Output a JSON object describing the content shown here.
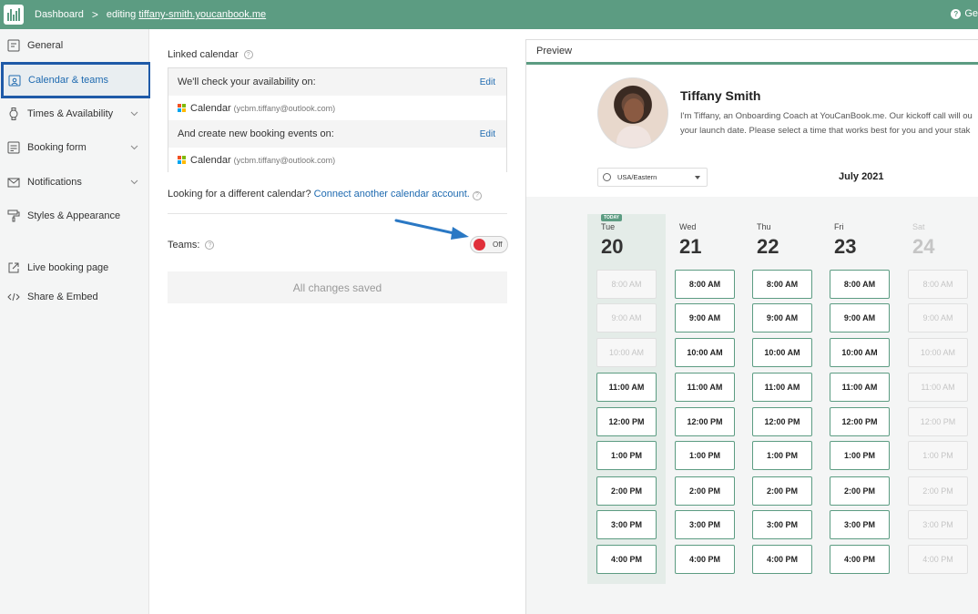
{
  "topbar": {
    "breadcrumb_root": "Dashboard",
    "breadcrumb_separator": ">",
    "editing_label": "editing",
    "editing_url": "tiffany-smith.youcanbook.me",
    "help_label": "Ge"
  },
  "sidebar": {
    "items": [
      {
        "label": "General",
        "icon": "id-card-icon"
      },
      {
        "label": "Calendar & teams",
        "icon": "calendar-user-icon",
        "active": true
      },
      {
        "label": "Times & Availability",
        "icon": "watch-icon",
        "expandable": true
      },
      {
        "label": "Booking form",
        "icon": "form-icon",
        "expandable": true
      },
      {
        "label": "Notifications",
        "icon": "envelope-icon",
        "expandable": true
      },
      {
        "label": "Styles & Appearance",
        "icon": "paint-roller-icon"
      },
      {
        "label": "Live booking page",
        "icon": "external-link-icon"
      },
      {
        "label": "Share & Embed",
        "icon": "code-icon"
      }
    ]
  },
  "main": {
    "linked_calendar_title": "Linked calendar",
    "check_label": "We'll check your availability on:",
    "check_edit": "Edit",
    "check_calendar": "Calendar",
    "check_calendar_account": "(ycbm.tiffany@outlook.com)",
    "create_label": "And create new booking events on:",
    "create_edit": "Edit",
    "create_calendar": "Calendar",
    "create_calendar_account": "(ycbm.tiffany@outlook.com)",
    "different_text": "Looking for a different calendar?",
    "different_link": "Connect another calendar account.",
    "teams_label": "Teams:",
    "teams_toggle": "Off",
    "saved_status": "All changes saved"
  },
  "preview": {
    "header": "Preview",
    "name": "Tiffany Smith",
    "desc_line1": "I'm Tiffany, an Onboarding Coach at YouCanBook.me. Our kickoff call will ou",
    "desc_line2": "your launch date. Please select a time that works best for you and your stak",
    "timezone": "USA/Eastern",
    "month": "July 2021",
    "today_badge": "TODAY",
    "days": [
      {
        "dow": "Tue",
        "num": "20",
        "today": true,
        "slots": [
          {
            "t": "8:00 AM",
            "on": false
          },
          {
            "t": "9:00 AM",
            "on": false
          },
          {
            "t": "10:00 AM",
            "on": false
          },
          {
            "t": "11:00 AM",
            "on": true
          },
          {
            "t": "12:00 PM",
            "on": true
          },
          {
            "t": "1:00 PM",
            "on": true
          },
          {
            "t": "2:00 PM",
            "on": true
          },
          {
            "t": "3:00 PM",
            "on": true
          },
          {
            "t": "4:00 PM",
            "on": true
          }
        ]
      },
      {
        "dow": "Wed",
        "num": "21",
        "slots": [
          {
            "t": "8:00 AM",
            "on": true
          },
          {
            "t": "9:00 AM",
            "on": true
          },
          {
            "t": "10:00 AM",
            "on": true
          },
          {
            "t": "11:00 AM",
            "on": true
          },
          {
            "t": "12:00 PM",
            "on": true
          },
          {
            "t": "1:00 PM",
            "on": true
          },
          {
            "t": "2:00 PM",
            "on": true
          },
          {
            "t": "3:00 PM",
            "on": true
          },
          {
            "t": "4:00 PM",
            "on": true
          }
        ]
      },
      {
        "dow": "Thu",
        "num": "22",
        "slots": [
          {
            "t": "8:00 AM",
            "on": true
          },
          {
            "t": "9:00 AM",
            "on": true
          },
          {
            "t": "10:00 AM",
            "on": true
          },
          {
            "t": "11:00 AM",
            "on": true
          },
          {
            "t": "12:00 PM",
            "on": true
          },
          {
            "t": "1:00 PM",
            "on": true
          },
          {
            "t": "2:00 PM",
            "on": true
          },
          {
            "t": "3:00 PM",
            "on": true
          },
          {
            "t": "4:00 PM",
            "on": true
          }
        ]
      },
      {
        "dow": "Fri",
        "num": "23",
        "slots": [
          {
            "t": "8:00 AM",
            "on": true
          },
          {
            "t": "9:00 AM",
            "on": true
          },
          {
            "t": "10:00 AM",
            "on": true
          },
          {
            "t": "11:00 AM",
            "on": true
          },
          {
            "t": "12:00 PM",
            "on": true
          },
          {
            "t": "1:00 PM",
            "on": true
          },
          {
            "t": "2:00 PM",
            "on": true
          },
          {
            "t": "3:00 PM",
            "on": true
          },
          {
            "t": "4:00 PM",
            "on": true
          }
        ]
      },
      {
        "dow": "Sat",
        "num": "24",
        "dim": true,
        "slots": [
          {
            "t": "8:00 AM",
            "on": false
          },
          {
            "t": "9:00 AM",
            "on": false
          },
          {
            "t": "10:00 AM",
            "on": false
          },
          {
            "t": "11:00 AM",
            "on": false
          },
          {
            "t": "12:00 PM",
            "on": false
          },
          {
            "t": "1:00 PM",
            "on": false
          },
          {
            "t": "2:00 PM",
            "on": false
          },
          {
            "t": "3:00 PM",
            "on": false
          },
          {
            "t": "4:00 PM",
            "on": false
          }
        ]
      }
    ]
  },
  "colors": {
    "brand_green": "#5c9c82",
    "active_border": "#1e5aa8",
    "link_blue": "#1e6ab0",
    "toggle_off_red": "#e0303a",
    "annotation_arrow": "#2a78c4"
  }
}
